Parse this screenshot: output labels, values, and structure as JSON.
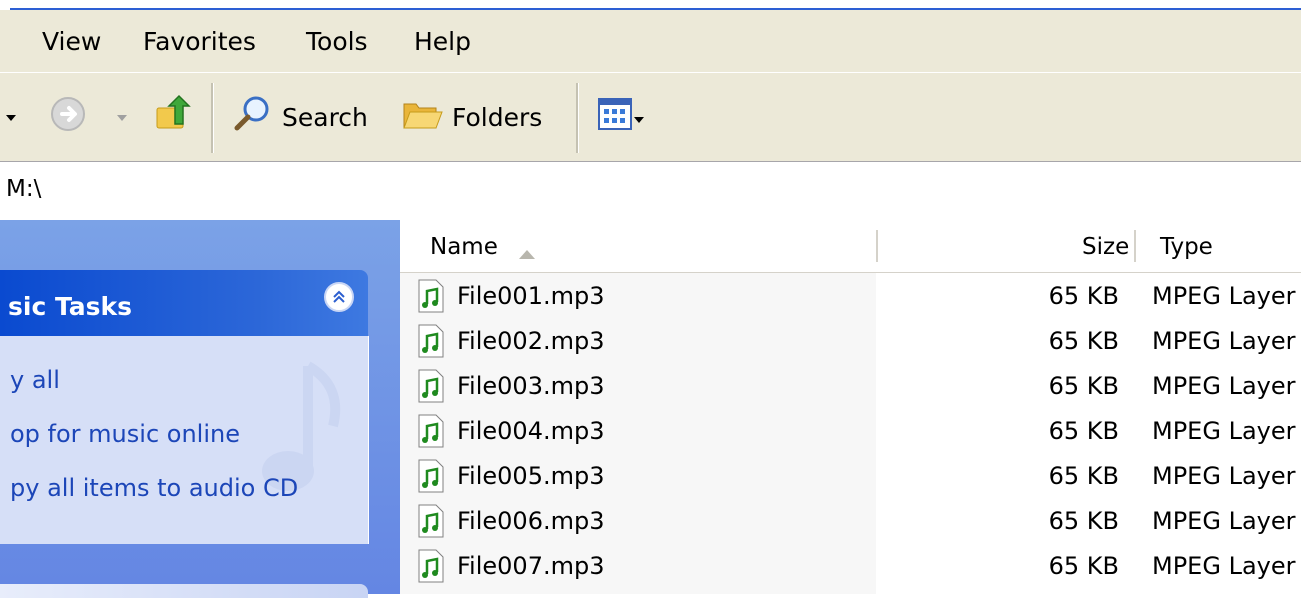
{
  "menu": {
    "items": [
      "View",
      "Favorites",
      "Tools",
      "Help"
    ]
  },
  "toolbar": {
    "search_label": "Search",
    "folders_label": "Folders"
  },
  "address": {
    "path": "M:\\"
  },
  "tasks": {
    "title": "sic Tasks",
    "links": [
      "y all",
      "op for music online",
      "py all items to audio CD"
    ]
  },
  "list": {
    "headers": {
      "name": "Name",
      "size": "Size",
      "type": "Type"
    },
    "files": [
      {
        "name": "File001.mp3",
        "size": "65 KB",
        "type": "MPEG Layer"
      },
      {
        "name": "File002.mp3",
        "size": "65 KB",
        "type": "MPEG Layer"
      },
      {
        "name": "File003.mp3",
        "size": "65 KB",
        "type": "MPEG Layer"
      },
      {
        "name": "File004.mp3",
        "size": "65 KB",
        "type": "MPEG Layer"
      },
      {
        "name": "File005.mp3",
        "size": "65 KB",
        "type": "MPEG Layer"
      },
      {
        "name": "File006.mp3",
        "size": "65 KB",
        "type": "MPEG Layer"
      },
      {
        "name": "File007.mp3",
        "size": "65 KB",
        "type": "MPEG Layer"
      }
    ]
  },
  "colors": {
    "accent": "#0a4ad0",
    "pane": "#6f93e5",
    "taskbody": "#d6dff7",
    "link": "#1c46b8",
    "chrome": "#ece9d8"
  },
  "icons": [
    "back-dropdown-icon",
    "forward-icon",
    "up-folder-icon",
    "search-icon",
    "folders-icon",
    "views-icon",
    "collapse-icon",
    "music-file-icon",
    "sort-ascending-icon"
  ]
}
